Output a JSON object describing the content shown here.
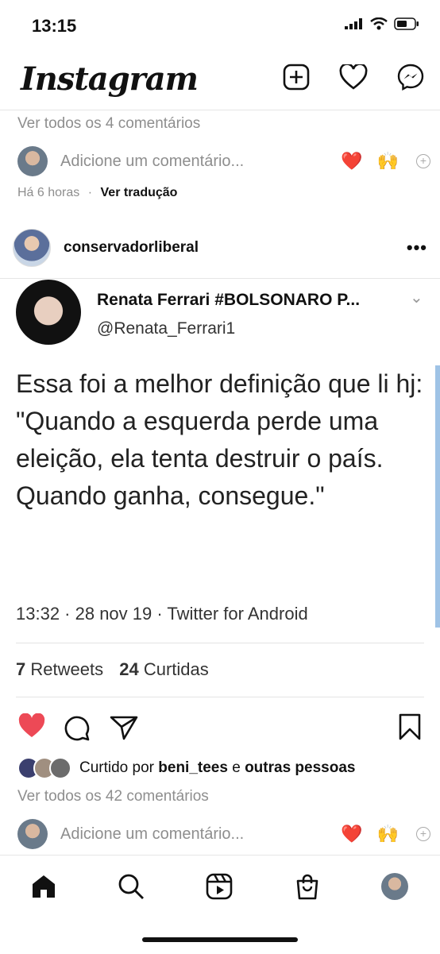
{
  "status": {
    "time": "13:15"
  },
  "header": {
    "logo": "Instagram",
    "icons": [
      "new-post-icon",
      "heart-icon",
      "messenger-icon"
    ]
  },
  "previous_post": {
    "view_comments": "Ver todos os 4 comentários",
    "add_comment_placeholder": "Adicione um comentário...",
    "quick_emojis": [
      "❤️",
      "🙌"
    ],
    "time_ago": "Há 6 horas",
    "separator": "·",
    "translate": "Ver tradução"
  },
  "post": {
    "username": "conservadorliberal",
    "more": "•••",
    "tweet": {
      "name": "Renata Ferrari #BOLSONARO P...",
      "handle": "@Renata_Ferrari1",
      "text": "Essa foi a melhor definição que li hj:\n\"Quando a esquerda perde uma eleição, ela tenta destruir o país. Quando ganha, consegue.\"",
      "meta": "13:32 · 28 nov 19 · Twitter for Android",
      "retweets_count": "7",
      "retweets_label": "Retweets",
      "likes_count": "24",
      "likes_label": "Curtidas"
    },
    "liked_by_prefix": "Curtido por",
    "liked_by_user": "beni_tees",
    "liked_by_joiner": "e",
    "liked_by_others": "outras pessoas",
    "view_comments": "Ver todos os 42 comentários",
    "add_comment_placeholder": "Adicione um comentário...",
    "quick_emojis": [
      "❤️",
      "🙌"
    ]
  },
  "tabbar": {
    "tabs": [
      "home-icon",
      "search-icon",
      "reels-icon",
      "shop-icon",
      "profile-avatar"
    ]
  },
  "colors": {
    "like_red": "#ed4956",
    "gray_text": "#8e8e8e"
  }
}
